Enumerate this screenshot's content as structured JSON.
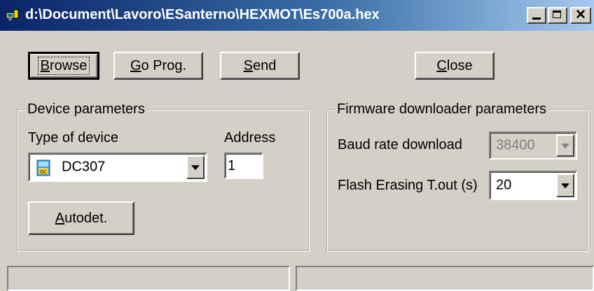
{
  "window": {
    "title": "d:\\Document\\Lavoro\\ESanterno\\HEXMOT\\Es700a.hex"
  },
  "toolbar": {
    "browse_label": "rowse",
    "browse_mn": "B",
    "goprog_label": "o Prog.",
    "goprog_mn": "G",
    "send_label": "end",
    "send_mn": "S",
    "close_label": "lose",
    "close_mn": "C"
  },
  "device": {
    "group_title": "Device parameters",
    "type_label": "Type of device",
    "type_value": "DC307",
    "device_icon_text": "DC",
    "address_label": "Address",
    "address_value": "1",
    "autodet_mn": "A",
    "autodet_label": "utodet."
  },
  "firmware": {
    "group_title": "Firmware downloader parameters",
    "baud_label": "Baud rate download",
    "baud_value": "38400",
    "flash_label": "Flash Erasing T.out (s)",
    "flash_value": "20"
  },
  "colors": {
    "title_bar": "#0a246a",
    "face": "#d4d0c8"
  }
}
